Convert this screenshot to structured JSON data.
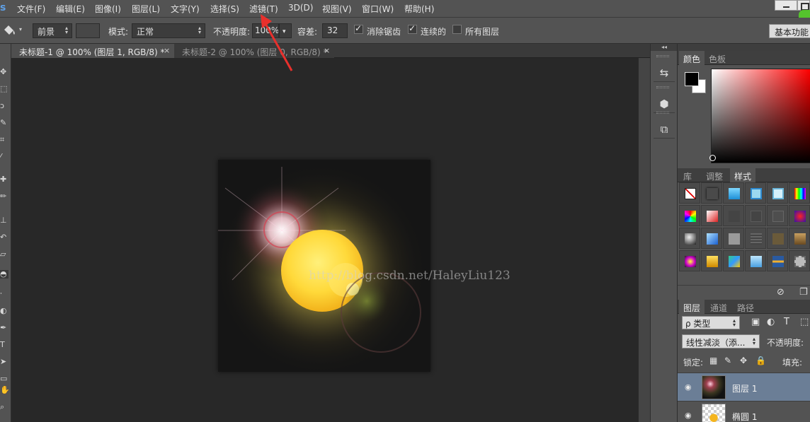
{
  "menu": {
    "items": [
      "文件(F)",
      "编辑(E)",
      "图像(I)",
      "图层(L)",
      "文字(Y)",
      "选择(S)",
      "滤镜(T)",
      "3D(D)",
      "视图(V)",
      "窗口(W)",
      "帮助(H)"
    ],
    "logo": "s"
  },
  "options": {
    "source_value": "前景",
    "mode_label": "模式:",
    "mode_value": "正常",
    "opacity_label": "不透明度:",
    "opacity_value": "100%",
    "tolerance_label": "容差:",
    "tolerance_value": "32",
    "antialias_label": "消除锯齿",
    "antialias_checked": true,
    "contiguous_label": "连续的",
    "contiguous_checked": true,
    "all_layers_label": "所有图层",
    "all_layers_checked": false,
    "workspace_label": "基本功能"
  },
  "documents": {
    "tabs": [
      {
        "label": "未标题-1 @ 100% (图层 1, RGB/8) *",
        "active": true
      },
      {
        "label": "未标题-2 @ 100% (图层 0, RGB/8) *",
        "active": false
      }
    ],
    "close_glyph": "×"
  },
  "canvas": {
    "watermark": "http://blog.csdn.net/HaleyLiu123"
  },
  "strip": {
    "collapse_glyph": "◂◂"
  },
  "color_panel": {
    "tabs": [
      "颜色",
      "色板"
    ],
    "foreground": "#000000",
    "background": "#ffffff"
  },
  "styles_panel": {
    "tabs": [
      "库",
      "调整",
      "样式"
    ]
  },
  "layers_panel": {
    "tabs": [
      "图层",
      "通道",
      "路径"
    ],
    "filter_label": "ρ 类型",
    "blend_mode": "线性减淡（添...",
    "opacity_label": "不透明度:",
    "lock_label": "锁定:",
    "fill_label": "填充:",
    "layers": [
      {
        "name": "图层 1",
        "visible": true,
        "selected": true
      },
      {
        "name": "椭圆 1",
        "visible": true,
        "selected": false
      }
    ]
  },
  "colors": {
    "accent_selection": "#6b7e96",
    "annotation_arrow": "#e8302c",
    "sun_fill": "#ffd93a"
  }
}
